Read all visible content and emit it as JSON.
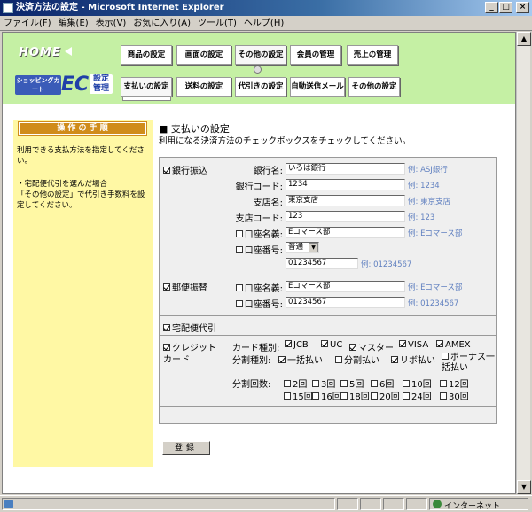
{
  "window": {
    "title": "決済方法の設定 - Microsoft Internet Explorer",
    "minimize": "_",
    "maximize": "□",
    "close": "×"
  },
  "menu": [
    "ファイル(F)",
    "編集(E)",
    "表示(V)",
    "お気に入り(A)",
    "ツール(T)",
    "ヘルプ(H)"
  ],
  "header": {
    "home": "HOME",
    "logo_shop": "ショッピングカート",
    "logo_ec": "EC",
    "logo_sub": "設定管理",
    "nav_top": [
      "商品の設定",
      "画面の設定",
      "その他の設定",
      "会員の管理",
      "売上の管理"
    ],
    "nav_bottom": [
      "支払いの設定",
      "送料の設定",
      "代引きの設定",
      "自動送信メール",
      "その他の設定"
    ]
  },
  "sidebar": {
    "caption": "操 作 の 手 順",
    "text1": "利用できる支払方法を指定してください。",
    "text2a": "・宅配便代引を選んだ場合",
    "text2b": "「その他の設定」で代引き手数料を設定してください。"
  },
  "main": {
    "title": "■ 支払いの設定",
    "desc": "利用になる決済方法のチェックボックスをチェックしてください。",
    "bank": {
      "label": "銀行振込",
      "checked": true,
      "fields": [
        {
          "label": "銀行名:",
          "value": "いろは銀行",
          "example": "例: ASJ銀行"
        },
        {
          "label": "銀行コード:",
          "value": "1234",
          "example": "例: 1234"
        },
        {
          "label": "支店名:",
          "value": "東京支店",
          "example": "例: 東京支店"
        },
        {
          "label": "支店コード:",
          "value": "123",
          "example": "例: 123"
        },
        {
          "label": "口座名義:",
          "value": "Eコマース部",
          "example": "例: Eコマース部"
        }
      ],
      "account_label": "口座番号:",
      "account_type": "普通",
      "account_number": "01234567",
      "account_example": "例: 01234567"
    },
    "postal": {
      "label": "郵便振替",
      "checked": true,
      "name_label": "口座名義:",
      "name_value": "Eコマース部",
      "name_example": "例: Eコマース部",
      "number_label": "口座番号:",
      "number_value": "01234567",
      "number_example": "例: 01234567"
    },
    "cod": {
      "label": "宅配便代引",
      "checked": true
    },
    "credit": {
      "label_line1": "クレジット",
      "label_line2": "カード",
      "checked": true,
      "card_type_label": "カード種別:",
      "card_types": [
        {
          "name": "JCB",
          "checked": true
        },
        {
          "name": "UC",
          "checked": true
        },
        {
          "name": "マスター",
          "checked": true
        },
        {
          "name": "VISA",
          "checked": true
        },
        {
          "name": "AMEX",
          "checked": true
        }
      ],
      "split_type_label": "分割種別:",
      "split_types": [
        {
          "name": "一括払い",
          "checked": true
        },
        {
          "name": "分割払い",
          "checked": false
        },
        {
          "name": "リボ払い",
          "checked": true
        },
        {
          "name": "ボーナス一括払い",
          "checked": false
        }
      ],
      "split_count_label": "分割回数:",
      "split_counts": [
        "2回",
        "3回",
        "5回",
        "6回",
        "10回",
        "12回",
        "15回",
        "16回",
        "18回",
        "20回",
        "24回",
        "30回"
      ]
    },
    "submit": "登録"
  },
  "status": {
    "zone": "インターネット"
  }
}
